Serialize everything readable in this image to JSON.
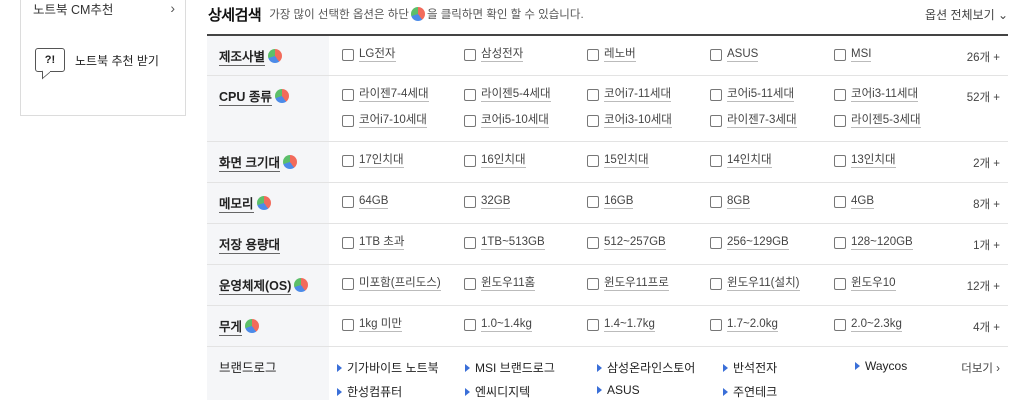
{
  "sidebar": {
    "cm_link": "노트북 CM추천",
    "cm_chevron": "›",
    "rec_icon": "?!",
    "rec_label": "노트북 추천 받기"
  },
  "header": {
    "title": "상세검색",
    "desc_before": "가장 많이 선택한 옵션은 하단",
    "desc_after": "을 클릭하면 확인 할 수 있습니다.",
    "all_options": "옵션 전체보기 ⌄"
  },
  "rows": [
    {
      "label": "제조사별",
      "pie": true,
      "count": "26개 +",
      "options": [
        "LG전자",
        "삼성전자",
        "레노버",
        "ASUS",
        "MSI"
      ]
    },
    {
      "label": "CPU 종류",
      "pie": true,
      "count": "52개 +",
      "options": [
        "라이젠7-4세대",
        "라이젠5-4세대",
        "코어i7-11세대",
        "코어i5-11세대",
        "코어i3-11세대",
        "코어i7-10세대",
        "코어i5-10세대",
        "코어i3-10세대",
        "라이젠7-3세대",
        "라이젠5-3세대"
      ]
    },
    {
      "label": "화면 크기대",
      "pie": true,
      "count": "2개 +",
      "options": [
        "17인치대",
        "16인치대",
        "15인치대",
        "14인치대",
        "13인치대"
      ]
    },
    {
      "label": "메모리",
      "pie": true,
      "count": "8개 +",
      "options": [
        "64GB",
        "32GB",
        "16GB",
        "8GB",
        "4GB"
      ]
    },
    {
      "label": "저장 용량대",
      "pie": false,
      "count": "1개 +",
      "options": [
        "1TB 초과",
        "1TB~513GB",
        "512~257GB",
        "256~129GB",
        "128~120GB"
      ]
    },
    {
      "label": "운영체제(OS)",
      "pie": true,
      "count": "12개 +",
      "options": [
        "미포함(프리도스)",
        "윈도우11홈",
        "윈도우11프로",
        "윈도우11(설치)",
        "윈도우10"
      ]
    },
    {
      "label": "무게",
      "pie": true,
      "count": "4개 +",
      "options": [
        "1kg 미만",
        "1.0~1.4kg",
        "1.4~1.7kg",
        "1.7~2.0kg",
        "2.0~2.3kg"
      ]
    }
  ],
  "brandlog": {
    "label": "브랜드로그",
    "more": "더보기 ›",
    "items": [
      "기가바이트 노트북",
      "MSI 브랜드로그",
      "삼성온라인스토어",
      "반석전자",
      "Waycos",
      "한성컴퓨터",
      "엔씨디지텍",
      "ASUS",
      "주연테크"
    ]
  },
  "colors": {
    "accent": "#3a6fd8",
    "label_bg": "#f5f6f8",
    "pie_red": "#f26b5b",
    "pie_blue": "#4c8be8",
    "pie_green": "#5cbf6a"
  }
}
